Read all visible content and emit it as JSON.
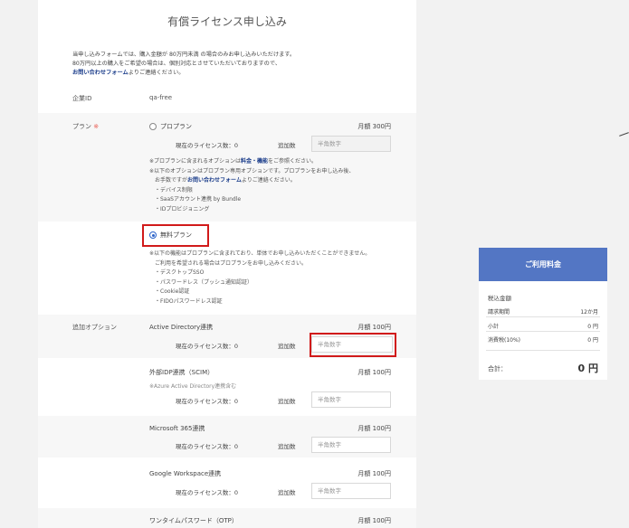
{
  "page": {
    "title": "有償ライセンス申し込み"
  },
  "intro": {
    "line1": "当申し込みフォームでは、購入金額が 80万円未満 の場合のみお申し込みいただけます。",
    "line2": "80万円以上の購入をご希望の場合は、個別対応とさせていただいておりますので、",
    "link": "お問い合わせフォーム",
    "line3_tail": "よりご連絡ください。"
  },
  "company": {
    "label": "企業ID",
    "value": "qa-free"
  },
  "plan": {
    "label": "プラン",
    "required_mark": "※",
    "pro": {
      "name": "プロプラン",
      "price": "月額 300円",
      "license_label": "現在のライセンス数：0",
      "add_label": "追加数",
      "placeholder": "半角数字",
      "note1_pre": "※プロプランに含まれるオプションは",
      "note1_link": "料金・機能",
      "note1_post": "をご参照ください。",
      "note2": "※以下のオプションはプロプラン専用オプションです。プロプランをお申し込み後、",
      "note3_pre": "お手数ですが",
      "note3_link": "お問い合わせフォーム",
      "note3_post": "よりご連絡ください。",
      "items": [
        "・デバイス制限",
        "・SaaSアカウント連携 by Bundle",
        "・IDプロビジョニング"
      ]
    },
    "free": {
      "name": "無料プラン",
      "note1": "※以下の機能はプロプランに含まれており、単体でお申し込みいただくことができません。",
      "note2": "ご利用を希望される場合はプロプランをお申し込みください。",
      "items": [
        "・デスクトップSSO",
        "・パスワードレス（プッシュ通知認証）",
        "・Cookie認証",
        "・FIDOパスワードレス認証"
      ]
    }
  },
  "options": {
    "label": "追加オプション",
    "license_label": "現在のライセンス数：0",
    "add_label": "追加数",
    "placeholder": "半角数字",
    "items": [
      {
        "name": "Active Directory連携",
        "price": "月額 100円"
      },
      {
        "name": "外部IDP連携（SCIM）",
        "price": "月額 100円",
        "sub": "※Azure Active Directory連携含む"
      },
      {
        "name": "Microsoft 365連携",
        "price": "月額 100円"
      },
      {
        "name": "Google Workspace連携",
        "price": "月額 100円"
      },
      {
        "name": "ワンタイムパスワード（OTP）",
        "price": "月額 100円"
      }
    ]
  },
  "fee_card": {
    "title": "ご利用料金",
    "tax_included_label": "税込金額",
    "rows": [
      {
        "label": "請求期間",
        "value": "12か月"
      },
      {
        "label": "小計",
        "value": "0 円"
      },
      {
        "label": "消費税(10%)",
        "value": "0 円"
      }
    ],
    "total_label": "合計：",
    "total_value": "0 円"
  },
  "colors": {
    "accent": "#5376c4",
    "link": "#1a3c8a",
    "highlight": "#d11a1a",
    "required": "#e8574d"
  }
}
